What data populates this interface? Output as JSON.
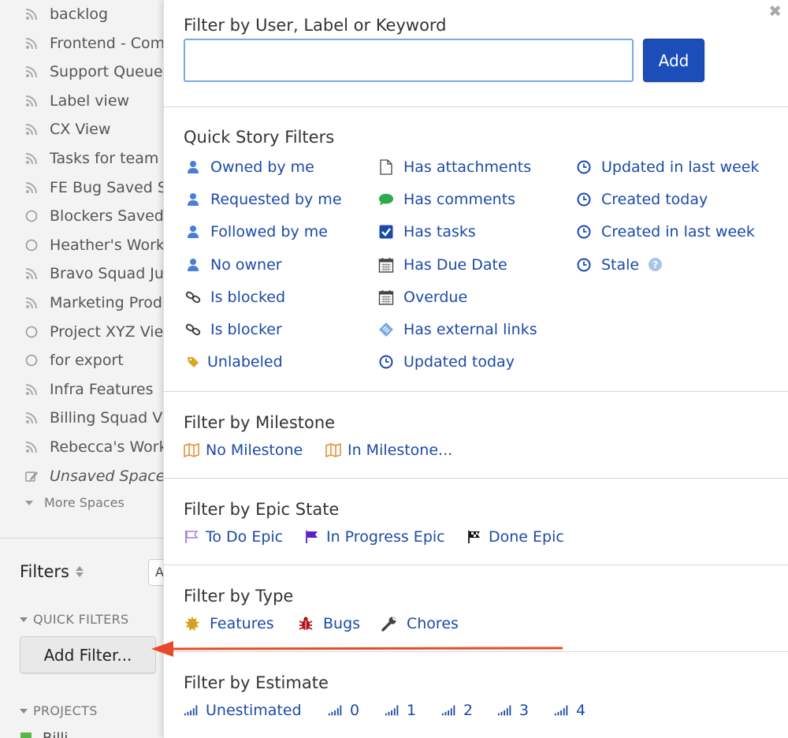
{
  "sidebar": {
    "spaces": [
      {
        "label": "backlog",
        "icon": "rss-icon"
      },
      {
        "label": "Frontend - Com",
        "icon": "rss-icon"
      },
      {
        "label": "Support Queue",
        "icon": "rss-icon"
      },
      {
        "label": "Label view",
        "icon": "rss-icon"
      },
      {
        "label": "CX View",
        "icon": "rss-icon"
      },
      {
        "label": "Tasks for team",
        "icon": "rss-icon"
      },
      {
        "label": "FE Bug Saved Sp",
        "icon": "rss-icon"
      },
      {
        "label": "Blockers Saved",
        "icon": "circle-icon"
      },
      {
        "label": "Heather's Work",
        "icon": "circle-icon"
      },
      {
        "label": "Bravo Squad Ju",
        "icon": "rss-icon"
      },
      {
        "label": "Marketing Prod",
        "icon": "rss-icon"
      },
      {
        "label": "Project XYZ Vie",
        "icon": "circle-icon"
      },
      {
        "label": "for export",
        "icon": "circle-icon"
      },
      {
        "label": "Infra Features",
        "icon": "rss-icon"
      },
      {
        "label": "Billing Squad Vi",
        "icon": "rss-icon"
      },
      {
        "label": "Rebecca's Work",
        "icon": "rss-icon"
      },
      {
        "label": "Unsaved Space",
        "icon": "edit-icon"
      }
    ],
    "more_spaces": "More Spaces",
    "filters_title": "Filters",
    "filters_select_value": "A",
    "quick_filters_header": "QUICK FILTERS",
    "add_filter_label": "Add Filter...",
    "projects_header": "PROJECTS",
    "project_partial": "Billi"
  },
  "panel": {
    "close": "✖",
    "keyword_title": "Filter by User, Label or Keyword",
    "keyword_input_value": "",
    "add_label": "Add",
    "quick_title": "Quick Story Filters",
    "quick_col1": [
      {
        "label": "Owned by me",
        "icon": "user-icon"
      },
      {
        "label": "Requested by me",
        "icon": "user-icon"
      },
      {
        "label": "Followed by me",
        "icon": "user-icon"
      },
      {
        "label": "No owner",
        "icon": "user-icon"
      },
      {
        "label": "Is blocked",
        "icon": "link-icon"
      },
      {
        "label": "Is blocker",
        "icon": "link-icon"
      },
      {
        "label": "Unlabeled",
        "icon": "tag-icon"
      }
    ],
    "quick_col2": [
      {
        "label": "Has attachments",
        "icon": "file-icon"
      },
      {
        "label": "Has comments",
        "icon": "comment-icon"
      },
      {
        "label": "Has tasks",
        "icon": "checkbox-icon"
      },
      {
        "label": "Has Due Date",
        "icon": "calendar-icon"
      },
      {
        "label": "Overdue",
        "icon": "calendar-icon"
      },
      {
        "label": "Has external links",
        "icon": "ticket-icon"
      },
      {
        "label": "Updated today",
        "icon": "clock-icon"
      }
    ],
    "quick_col3": [
      {
        "label": "Updated in last week",
        "icon": "clock-icon"
      },
      {
        "label": "Created today",
        "icon": "clock-icon"
      },
      {
        "label": "Created in last week",
        "icon": "clock-icon"
      },
      {
        "label": "Stale",
        "icon": "clock-icon"
      }
    ],
    "stale_help": "?",
    "milestone_title": "Filter by Milestone",
    "milestones": [
      {
        "label": "No Milestone",
        "icon": "map-icon"
      },
      {
        "label": "In Milestone...",
        "icon": "map-icon"
      }
    ],
    "epic_title": "Filter by Epic State",
    "epics": [
      {
        "label": "To Do Epic",
        "icon": "flag-outline-icon"
      },
      {
        "label": "In Progress Epic",
        "icon": "flag-purple-icon"
      },
      {
        "label": "Done Epic",
        "icon": "flag-checkered-icon"
      }
    ],
    "type_title": "Filter by Type",
    "types": [
      {
        "label": "Features",
        "icon": "feature-icon"
      },
      {
        "label": "Bugs",
        "icon": "bug-icon"
      },
      {
        "label": "Chores",
        "icon": "wrench-icon"
      }
    ],
    "estimate_title": "Filter by Estimate",
    "estimates": [
      {
        "label": "Unestimated",
        "icon": "estimate-bars-icon"
      },
      {
        "label": "0",
        "icon": "estimate-bars-icon"
      },
      {
        "label": "1",
        "icon": "estimate-bars-icon"
      },
      {
        "label": "2",
        "icon": "estimate-bars-icon"
      },
      {
        "label": "3",
        "icon": "estimate-bars-icon"
      },
      {
        "label": "4",
        "icon": "estimate-bars-icon"
      }
    ]
  },
  "colors": {
    "link_blue": "#1b4aa8",
    "add_button": "#1b4eb8",
    "arrow_red": "#e8492a"
  }
}
